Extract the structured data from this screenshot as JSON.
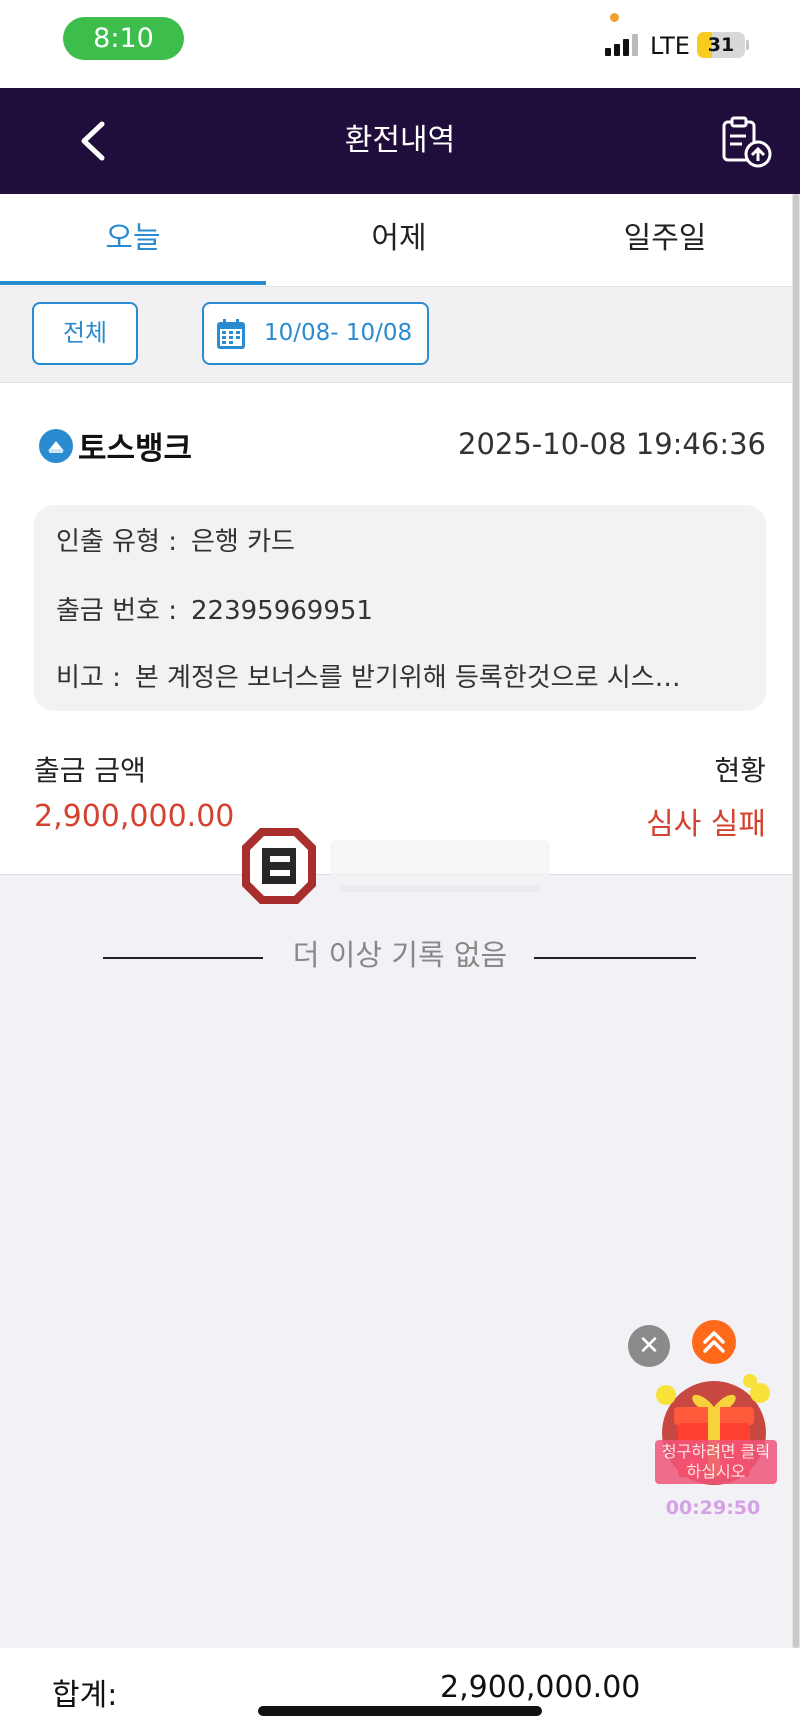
{
  "status_bar": {
    "time": "8:10",
    "network": "LTE",
    "battery": "31"
  },
  "header": {
    "title": "환전내역"
  },
  "tabs": [
    {
      "label": "오늘",
      "active": true
    },
    {
      "label": "어제",
      "active": false
    },
    {
      "label": "일주일",
      "active": false
    }
  ],
  "filter": {
    "all_label": "전체",
    "date_range": "10/08- 10/08"
  },
  "record": {
    "bank_name": "토스뱅크",
    "datetime": "2025-10-08 19:46:36",
    "withdraw_type_label": "인출 유형 :",
    "withdraw_type_value": "은행 카드",
    "withdraw_no_label": "출금 번호 :",
    "withdraw_no_value": "22395969951",
    "note_label": "비고 :",
    "note_value": "본 계정은 보너스를 받기위해 등록한것으로 시스…",
    "amount_label": "출금 금액",
    "amount_value": "2,900,000.00",
    "status_label": "현황",
    "status_value": "심사 실패"
  },
  "no_more_text": "더 이상 기록 없음",
  "floating": {
    "gift_label": "청구하려면 클릭하십시오",
    "timer": "00:29:50"
  },
  "footer": {
    "total_label": "합계:",
    "total_value": "2,900,000.00"
  },
  "colors": {
    "header_bg": "#1f0e3b",
    "accent": "#2a8bd0",
    "danger": "#d4432f"
  }
}
